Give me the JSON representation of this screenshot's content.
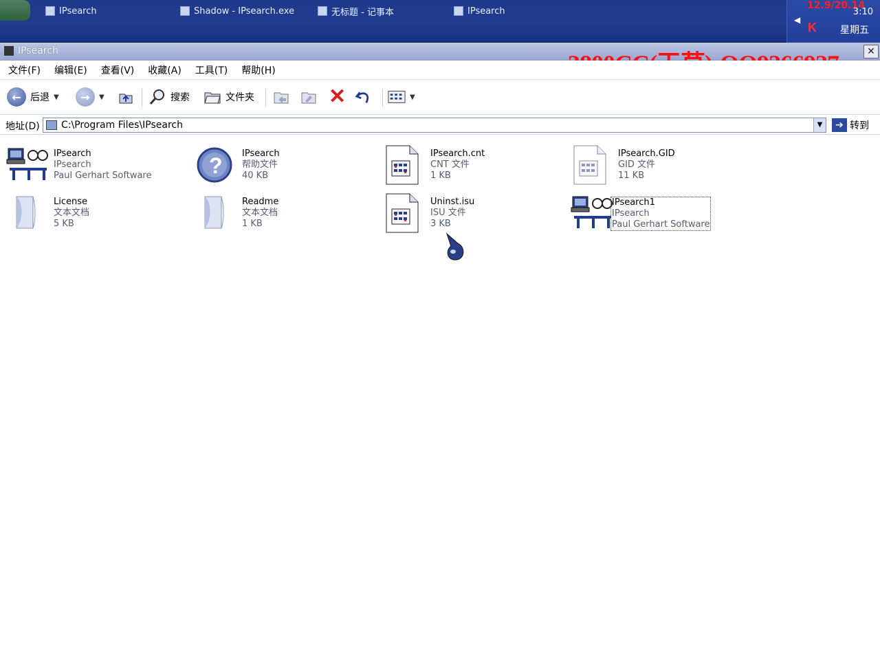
{
  "taskbar": {
    "buttons": [
      {
        "label": "IPsearch"
      },
      {
        "label": "Shadow - IPsearch.exe"
      },
      {
        "label": "无标题 - 记事本"
      },
      {
        "label": "IPsearch"
      }
    ],
    "tray_date": "12.9/20.14",
    "tray_time": "3:10",
    "tray_day": "星期五"
  },
  "window": {
    "title": "IPsearch",
    "watermark": "3800CC(天草)-QQ9266927",
    "close_label": "✕"
  },
  "menu": {
    "items": [
      "文件(F)",
      "编辑(E)",
      "查看(V)",
      "收藏(A)",
      "工具(T)",
      "帮助(H)"
    ]
  },
  "toolbar": {
    "back_label": "后退",
    "search_label": "搜索",
    "folders_label": "文件夹"
  },
  "address": {
    "label": "地址(D)",
    "path": "C:\\Program Files\\IPsearch",
    "go_label": "转到"
  },
  "files": [
    {
      "name": "IPsearch",
      "type": "IPsearch",
      "size": "Paul Gerhart Software",
      "icon": "network-glasses-icon"
    },
    {
      "name": "IPsearch",
      "type": "帮助文件",
      "size": "40 KB",
      "icon": "help-icon"
    },
    {
      "name": "IPsearch.cnt",
      "type": "CNT 文件",
      "size": "1 KB",
      "icon": "document-grid-icon"
    },
    {
      "name": "IPsearch.GID",
      "type": "GID 文件",
      "size": "11 KB",
      "icon": "document-grid-icon"
    },
    {
      "name": "License",
      "type": "文本文档",
      "size": "5 KB",
      "icon": "text-document-icon"
    },
    {
      "name": "Readme",
      "type": "文本文档",
      "size": "1 KB",
      "icon": "text-document-icon"
    },
    {
      "name": "Uninst.isu",
      "type": "ISU 文件",
      "size": "3 KB",
      "icon": "document-grid-icon"
    },
    {
      "name": "IPsearch1",
      "type": "IPsearch",
      "size": "Paul Gerhart Software",
      "icon": "network-glasses-icon"
    }
  ],
  "colors": {
    "taskbar": "#203b8f",
    "watermark": "#ff1010",
    "titlebar": "#9aa8d2"
  }
}
